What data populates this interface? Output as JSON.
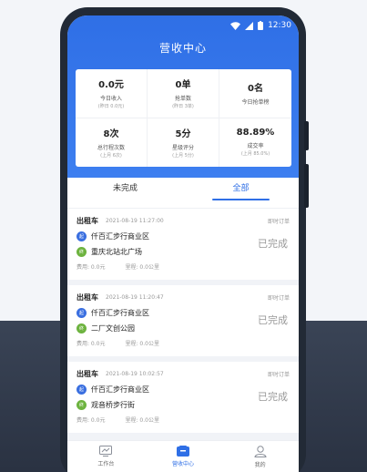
{
  "status_bar": {
    "time": "12:30"
  },
  "header": {
    "title": "营收中心"
  },
  "stats": [
    {
      "value": "0.0元",
      "label": "今日收入",
      "sub": "(昨日 0.0元)"
    },
    {
      "value": "0单",
      "label": "抢单数",
      "sub": "(昨日 3单)"
    },
    {
      "value": "0名",
      "label": "今日抢单榜",
      "sub": ""
    },
    {
      "value": "8次",
      "label": "总行程次数",
      "sub": "(上月 6次)"
    },
    {
      "value": "5分",
      "label": "星级评分",
      "sub": "(上月 5分)"
    },
    {
      "value": "88.89%",
      "label": "成交率",
      "sub": "(上月 85.0%)"
    }
  ],
  "tabs": [
    {
      "label": "未完成"
    },
    {
      "label": "全部"
    }
  ],
  "badges": {
    "start": "起",
    "end": "终"
  },
  "orders": [
    {
      "type": "出租车",
      "time": "2021-08-19 11:27:00",
      "kind": "即时订单",
      "start": "仟百汇步行商业区",
      "end": "重庆北站北广场",
      "fee": "费用: 0.0元",
      "distance": "里程: 0.0公里",
      "status": "已完成"
    },
    {
      "type": "出租车",
      "time": "2021-08-19 11:20:47",
      "kind": "即时订单",
      "start": "仟百汇步行商业区",
      "end": "二厂文创公园",
      "fee": "费用: 0.0元",
      "distance": "里程: 0.0公里",
      "status": "已完成"
    },
    {
      "type": "出租车",
      "time": "2021-08-19 10:02:57",
      "kind": "即时订单",
      "start": "仟百汇步行商业区",
      "end": "观音桥步行街",
      "fee": "费用: 0.0元",
      "distance": "里程: 0.0公里",
      "status": "已完成"
    }
  ],
  "navbar": [
    {
      "label": "工作台",
      "icon": "monitor-icon"
    },
    {
      "label": "营收中心",
      "icon": "wallet-icon"
    },
    {
      "label": "我的",
      "icon": "user-icon"
    }
  ],
  "colors": {
    "accent": "#2f6fe6",
    "start_badge": "#3a6fe0",
    "end_badge": "#6db33f"
  }
}
